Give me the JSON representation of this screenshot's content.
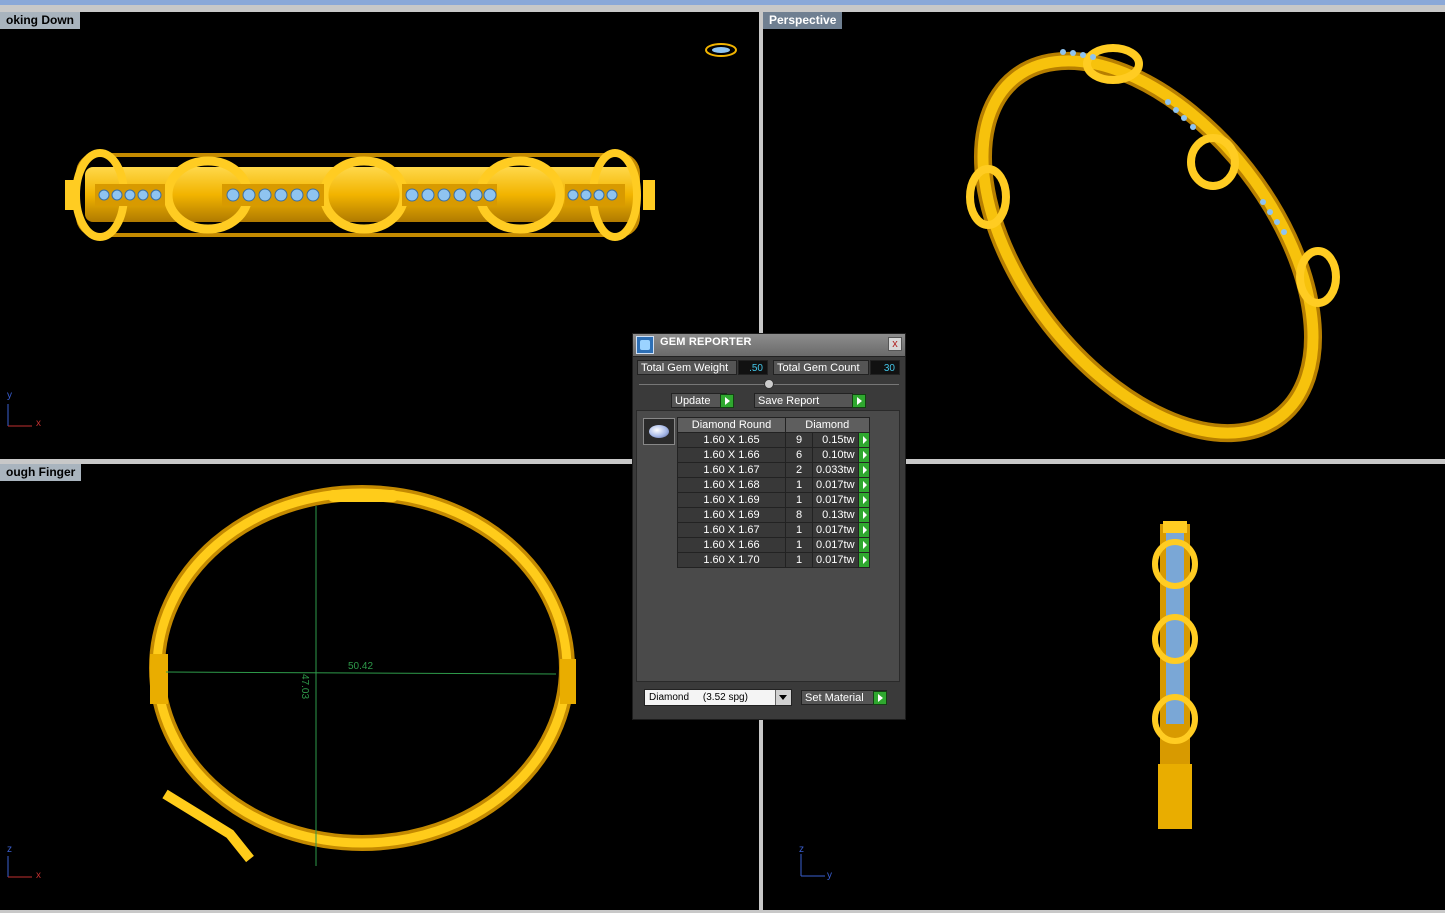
{
  "viewports": {
    "top_left": {
      "label": "oking Down",
      "axes": {
        "v": "y",
        "h": "x"
      }
    },
    "top_right": {
      "label": "Perspective"
    },
    "bottom_left": {
      "label": "ough Finger",
      "axes": {
        "v": "z",
        "h": "x"
      },
      "dimensions": {
        "horizontal": "50.42",
        "vertical": "47.03"
      }
    },
    "bottom_right": {
      "axes": {
        "v": "z",
        "h": "y"
      }
    }
  },
  "gem_reporter": {
    "title": "GEM REPORTER",
    "close_symbol": "x",
    "total_gem_weight_label": "Total Gem Weight",
    "total_gem_weight_value": ".50",
    "total_gem_count_label": "Total Gem Count",
    "total_gem_count_value": "30",
    "update_label": "Update",
    "save_report_label": "Save Report",
    "table": {
      "headers": [
        "Diamond Round",
        "Diamond"
      ],
      "rows": [
        {
          "size": "1.60 X 1.65",
          "count": "9",
          "weight": "0.15tw"
        },
        {
          "size": "1.60 X 1.66",
          "count": "6",
          "weight": "0.10tw"
        },
        {
          "size": "1.60 X 1.67",
          "count": "2",
          "weight": "0.033tw"
        },
        {
          "size": "1.60 X 1.68",
          "count": "1",
          "weight": "0.017tw"
        },
        {
          "size": "1.60 X 1.69",
          "count": "1",
          "weight": "0.017tw"
        },
        {
          "size": "1.60 X 1.69",
          "count": "8",
          "weight": "0.13tw"
        },
        {
          "size": "1.60 X 1.67",
          "count": "1",
          "weight": "0.017tw"
        },
        {
          "size": "1.60 X 1.66",
          "count": "1",
          "weight": "0.017tw"
        },
        {
          "size": "1.60 X 1.70",
          "count": "1",
          "weight": "0.017tw"
        }
      ]
    },
    "material_select_value": "Diamond     (3.52 spg)",
    "set_material_label": "Set Material"
  },
  "colors": {
    "gold": "#f2b400",
    "gem_blue": "#8fc4f0",
    "measure_green": "#2e9a4a"
  }
}
